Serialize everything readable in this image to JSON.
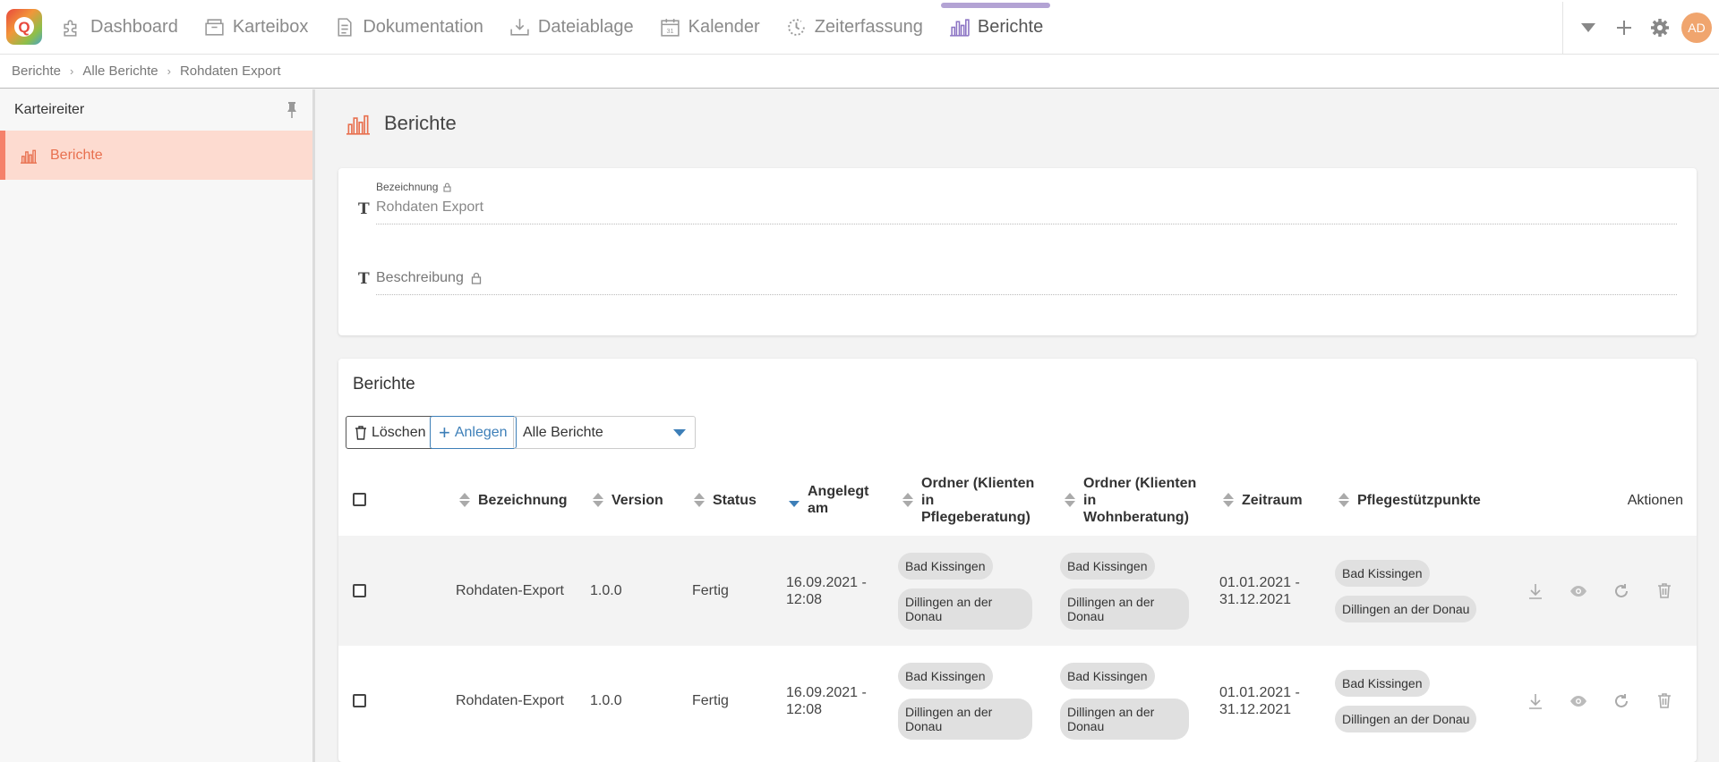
{
  "nav": {
    "items": [
      {
        "label": "Dashboard",
        "icon": "puzzle-icon"
      },
      {
        "label": "Karteibox",
        "icon": "box-icon"
      },
      {
        "label": "Dokumentation",
        "icon": "document-icon"
      },
      {
        "label": "Dateiablage",
        "icon": "download-tray-icon"
      },
      {
        "label": "Kalender",
        "icon": "calendar-icon"
      },
      {
        "label": "Zeiterfassung",
        "icon": "clock-icon"
      },
      {
        "label": "Berichte",
        "icon": "bar-chart-icon",
        "active": true
      }
    ],
    "avatar": "AD"
  },
  "breadcrumb": [
    "Berichte",
    "Alle Berichte",
    "Rohdaten Export"
  ],
  "sidebar": {
    "title": "Karteireiter",
    "items": [
      {
        "label": "Berichte"
      }
    ]
  },
  "page": {
    "title": "Berichte"
  },
  "form": {
    "bezeichnung_label": "Bezeichnung",
    "bezeichnung_value": "Rohdaten Export",
    "beschreibung_placeholder": "Beschreibung"
  },
  "table": {
    "title": "Berichte",
    "delete_label": "Löschen",
    "add_label": "Anlegen",
    "filter_value": "Alle Berichte",
    "columns": {
      "bezeichnung": "Bezeichnung",
      "version": "Version",
      "status": "Status",
      "angelegt_1": "Angelegt",
      "angelegt_2": "am",
      "ordner_pb_1": "Ordner (Klienten",
      "ordner_pb_2": "in",
      "ordner_pb_3": "Pflegeberatung)",
      "ordner_wb_1": "Ordner (Klienten",
      "ordner_wb_2": "in",
      "ordner_wb_3": "Wohnberatung)",
      "zeitraum": "Zeitraum",
      "pflegestuetzpunkte": "Pflegestützpunkte",
      "aktionen": "Aktionen"
    },
    "rows": [
      {
        "bezeichnung": "Rohdaten-Export",
        "version": "1.0.0",
        "status": "Fertig",
        "angelegt_1": "16.09.2021 -",
        "angelegt_2": "12:08",
        "ordner_pb": [
          "Bad Kissingen",
          "Dillingen an der",
          "Donau"
        ],
        "ordner_wb": [
          "Bad Kissingen",
          "Dillingen an der",
          "Donau"
        ],
        "zeitraum_1": "01.01.2021 -",
        "zeitraum_2": "31.12.2021",
        "pflegestuetzpunkte": [
          "Bad Kissingen",
          "Dillingen an der Donau"
        ]
      },
      {
        "bezeichnung": "Rohdaten-Export",
        "version": "1.0.0",
        "status": "Fertig",
        "angelegt_1": "16.09.2021 -",
        "angelegt_2": "12:08",
        "ordner_pb": [
          "Bad Kissingen",
          "Dillingen an der",
          "Donau"
        ],
        "ordner_wb": [
          "Bad Kissingen",
          "Dillingen an der",
          "Donau"
        ],
        "zeitraum_1": "01.01.2021 -",
        "zeitraum_2": "31.12.2021",
        "pflegestuetzpunkte": [
          "Bad Kissingen",
          "Dillingen an der Donau"
        ]
      }
    ]
  },
  "colors": {
    "accent": "#f5816a",
    "active_tab": "#b3a3d4",
    "primary": "#3d7fb8",
    "avatar": "#f0a56e"
  }
}
